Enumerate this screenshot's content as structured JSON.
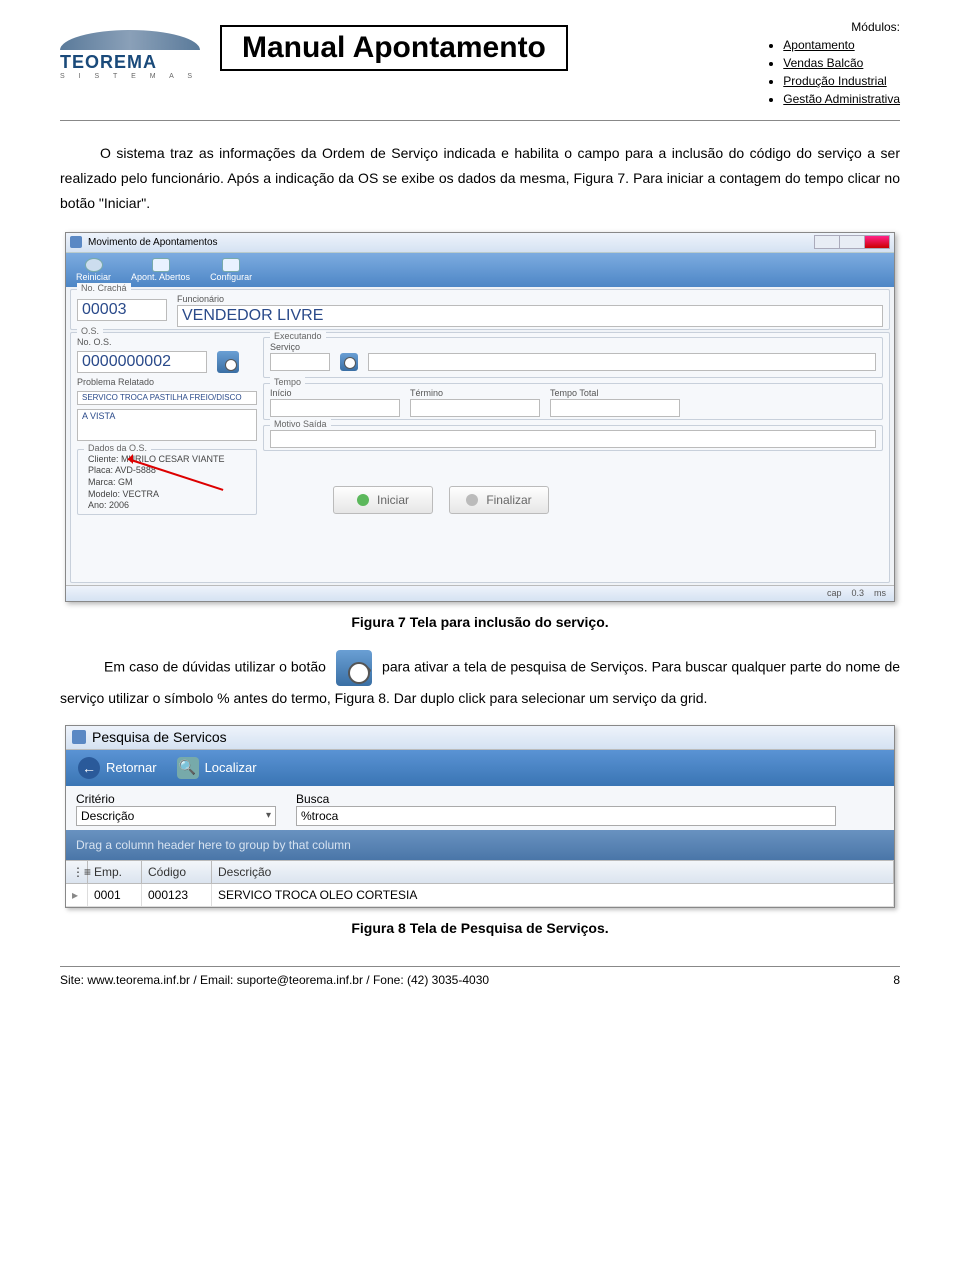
{
  "document": {
    "title": "Manual Apontamento",
    "logo_name": "TEOREMA",
    "logo_sub": "S I S T E M A S",
    "modules_head": "Módulos:",
    "modules": [
      "Apontamento",
      "Vendas Balcão",
      "Produção Industrial",
      "Gestão Administrativa"
    ]
  },
  "paragraph1": "O sistema traz as informações da Ordem de Serviço indicada e habilita o campo para a inclusão do código do serviço a ser realizado pelo funcionário. Após a indicação da OS se exibe os dados da mesma, Figura 7. Para iniciar a contagem do tempo clicar no botão \"Iniciar\".",
  "caption1": "Figura 7 Tela para inclusão do serviço.",
  "paragraph2_pre": "Em caso de dúvidas utilizar o botão",
  "paragraph2_post": "para ativar a tela de pesquisa de Serviços. Para buscar qualquer parte do nome de serviço utilizar o símbolo % antes do termo, Figura 8. Dar duplo click para selecionar um serviço da grid.",
  "caption2": "Figura 8 Tela de Pesquisa de Serviços.",
  "shot1": {
    "window_title": "Movimento de Apontamentos",
    "toolbar": {
      "reiniciar": "Reiniciar",
      "apont": "Apont. Abertos",
      "config": "Configurar"
    },
    "no_cracha_label": "No. Crachá",
    "no_cracha": "00003",
    "funcionario_label": "Funcionário",
    "funcionario": "VENDEDOR LIVRE",
    "os_label": "O.S.",
    "no_os_label": "No. O.S.",
    "no_os": "0000000002",
    "executando_label": "Executando",
    "servico_label": "Serviço",
    "problema_label": "Problema Relatado",
    "problema": "SERVICO TROCA PASTILHA FREIO/DISCO",
    "tempo_label": "Tempo",
    "inicio_label": "Início",
    "termino_label": "Término",
    "tempo_total_label": "Tempo Total",
    "avista": "A VISTA",
    "motivo_label": "Motivo Saída",
    "dados_label": "Dados da O.S.",
    "dados_lines": [
      "Cliente: MURILO CESAR VIANTE",
      "Placa: AVD-5888",
      "Marca: GM",
      "Modelo: VECTRA",
      "Ano: 2006"
    ],
    "btn_iniciar": "Iniciar",
    "btn_finalizar": "Finalizar",
    "status_cap": "cap",
    "status_val": "0.3",
    "status_unit": "ms"
  },
  "shot2": {
    "window_title": "Pesquisa de Servicos",
    "btn_retornar": "Retornar",
    "btn_localizar": "Localizar",
    "criterio_label": "Critério",
    "criterio_value": "Descrição",
    "busca_label": "Busca",
    "busca_value": "%troca",
    "group_hint": "Drag a column header here to group by that column",
    "cols": {
      "emp": "Emp.",
      "codigo": "Código",
      "descricao": "Descrição"
    },
    "row": {
      "emp": "0001",
      "codigo": "000123",
      "descricao": "SERVICO TROCA OLEO CORTESIA"
    }
  },
  "footer": {
    "left": "Site: www.teorema.inf.br / Email: suporte@teorema.inf.br / Fone: (42) 3035-4030",
    "page": "8"
  }
}
